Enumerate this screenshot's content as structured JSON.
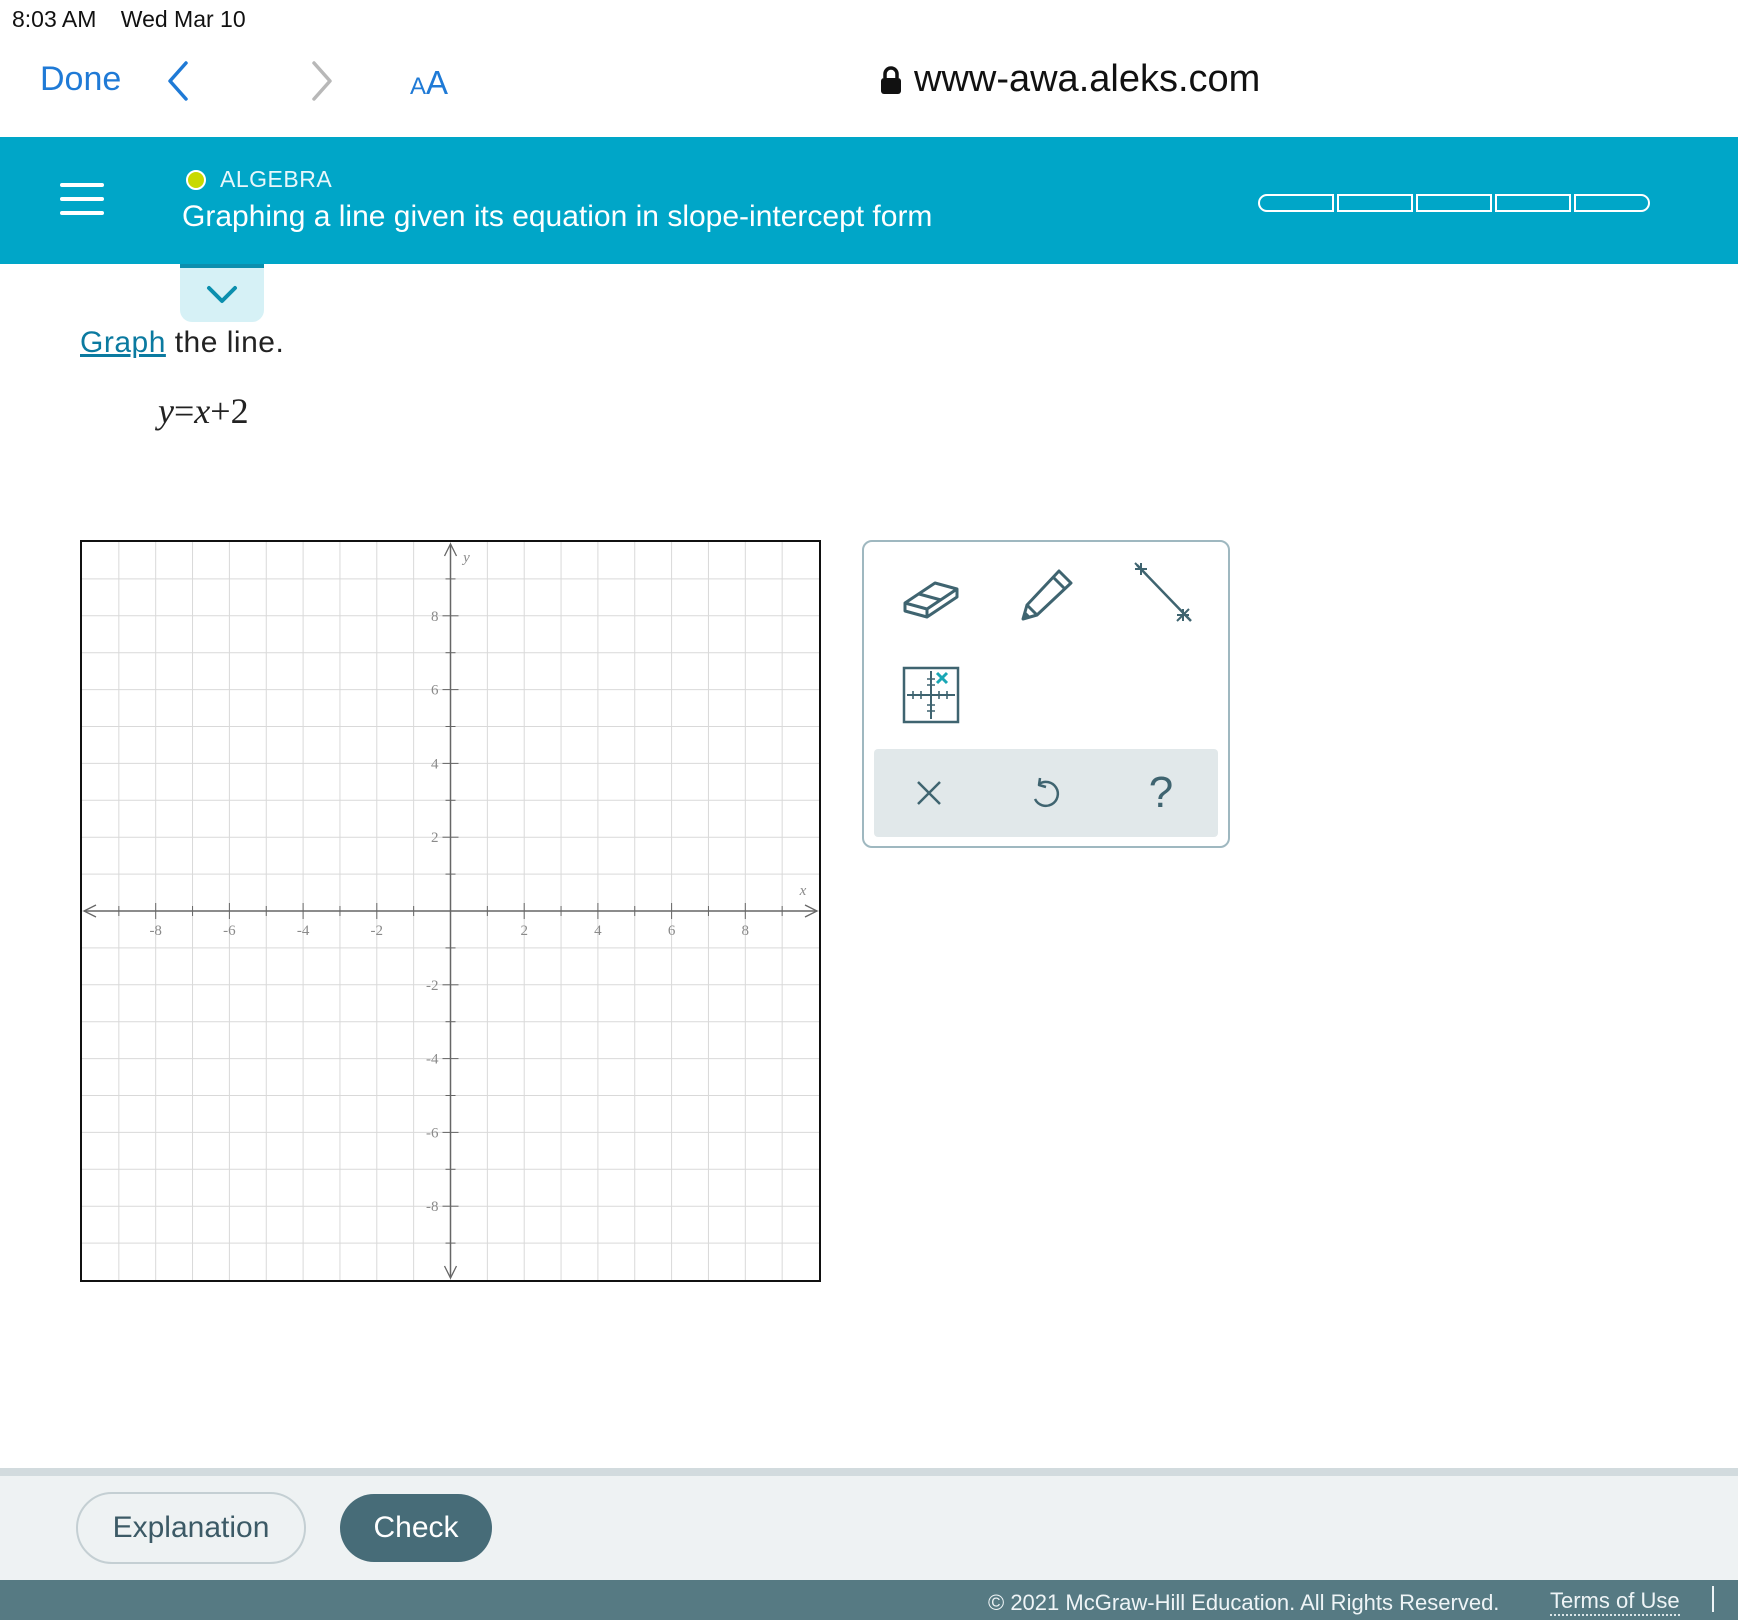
{
  "status_bar": {
    "time": "8:03 AM",
    "date": "Wed Mar 10"
  },
  "browser": {
    "done_label": "Done",
    "text_size_small": "A",
    "text_size_big": "A",
    "url": "www-awa.aleks.com"
  },
  "header": {
    "subject": "ALGEBRA",
    "topic": "Graphing a line given its equation in slope-intercept form",
    "accent_color": "#00a6c8",
    "subject_dot_color": "#c8d900",
    "progress_segments": 5
  },
  "problem": {
    "prompt_link": "Graph",
    "prompt_rest": " the line.",
    "eq_y": "y",
    "eq_equals": "=",
    "eq_x": "x",
    "eq_plus": "+",
    "eq_const": "2"
  },
  "graph": {
    "x_axis_label": "x",
    "y_axis_label": "y",
    "x_range": [
      -10,
      10
    ],
    "y_range": [
      -10,
      10
    ],
    "grid": true,
    "x_tick_labels": [
      "-8",
      "-6",
      "-4",
      "-2",
      "2",
      "4",
      "6",
      "8"
    ],
    "y_tick_labels": [
      "8",
      "6",
      "4",
      "2",
      "-2",
      "-4",
      "-6",
      "-8"
    ]
  },
  "tools": {
    "icons": [
      "eraser-icon",
      "pencil-icon",
      "line-segment-icon",
      "point-grid-icon",
      "clear-icon",
      "undo-icon",
      "help-icon"
    ],
    "help_label": "?"
  },
  "footer": {
    "explanation_label": "Explanation",
    "check_label": "Check",
    "copyright": "© 2021 McGraw-Hill Education. All Rights Reserved.",
    "terms_label": "Terms of Use"
  }
}
